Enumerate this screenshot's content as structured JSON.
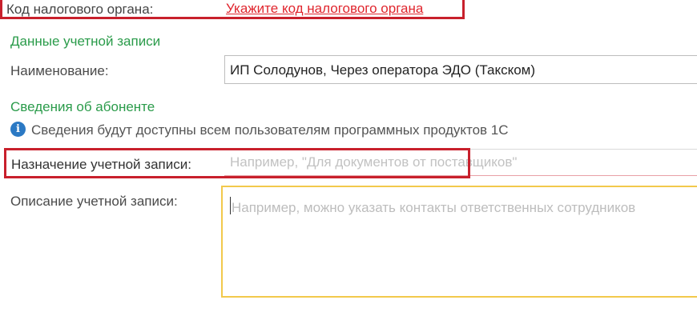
{
  "tax_authority": {
    "label": "Код налогового органа:",
    "link": "Укажите код налогового органа",
    "highlight_color": "#c8202c"
  },
  "account_data": {
    "section_title": "Данные учетной записи",
    "name_label": "Наименование:",
    "name_value": "ИП Солодунов, Через оператора ЭДО (Такском)"
  },
  "subscriber": {
    "section_title": "Сведения об абоненте",
    "info_icon": "info-icon",
    "info_text": "Сведения будут доступны всем пользователям программных продуктов 1С"
  },
  "purpose": {
    "label": "Назначение учетной записи:",
    "placeholder": "Например, \"Для документов от поставщиков\""
  },
  "description": {
    "label": "Описание учетной записи:",
    "placeholder": "Например, можно указать контакты ответственных сотрудников",
    "focus_color": "#f2c94c"
  },
  "colors": {
    "section_title": "#2a9b4a",
    "link": "#e0262e",
    "info_icon": "#2b79c4"
  }
}
